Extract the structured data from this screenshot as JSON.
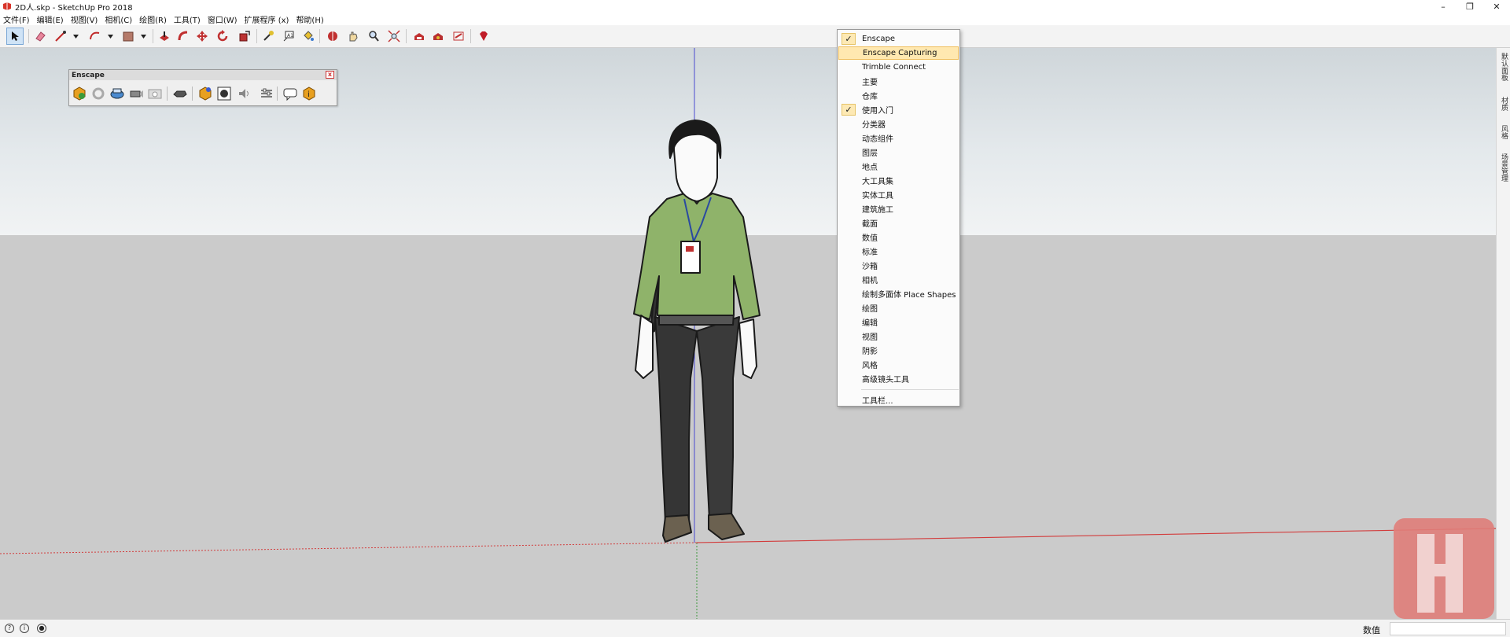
{
  "window": {
    "title": "2D人.skp - SketchUp Pro 2018",
    "minimize": "–",
    "restore": "❐",
    "close": "✕"
  },
  "menubar": [
    {
      "label": "文件(F)"
    },
    {
      "label": "编辑(E)"
    },
    {
      "label": "视图(V)"
    },
    {
      "label": "相机(C)"
    },
    {
      "label": "绘图(R)"
    },
    {
      "label": "工具(T)"
    },
    {
      "label": "窗口(W)"
    },
    {
      "label": "扩展程序 (x)"
    },
    {
      "label": "帮助(H)"
    }
  ],
  "right_tray": {
    "tabs": [
      "默认面板",
      "材质",
      "风格",
      "场景管理"
    ]
  },
  "enscape_toolbar": {
    "title": "Enscape",
    "close": "x"
  },
  "context_menu": {
    "items": [
      {
        "label": "Enscape",
        "checked": true
      },
      {
        "label": "Enscape Capturing",
        "hover": true
      },
      {
        "label": "Trimble Connect"
      },
      {
        "label": "主要"
      },
      {
        "label": "仓库"
      },
      {
        "label": "使用入门",
        "checked": true
      },
      {
        "label": "分类器"
      },
      {
        "label": "动态组件"
      },
      {
        "label": "图层"
      },
      {
        "label": "地点"
      },
      {
        "label": "大工具集"
      },
      {
        "label": "实体工具"
      },
      {
        "label": "建筑施工"
      },
      {
        "label": "截面"
      },
      {
        "label": "数值"
      },
      {
        "label": "标准"
      },
      {
        "label": "沙箱"
      },
      {
        "label": "相机"
      },
      {
        "label": "绘制多面体 Place Shapes"
      },
      {
        "label": "绘图"
      },
      {
        "label": "编辑"
      },
      {
        "label": "视图"
      },
      {
        "label": "阴影"
      },
      {
        "label": "风格"
      },
      {
        "label": "高级镜头工具"
      }
    ],
    "footer": "工具栏...",
    "check_glyph": "✓"
  },
  "statusbar": {
    "measurements_label": "数值",
    "icons": [
      "?",
      "i",
      "●"
    ]
  },
  "colors": {
    "sky": "#dde3e6",
    "ground": "#cbcbcb",
    "red_axis": "#d23c3c",
    "blue_axis": "#4a4ad0",
    "green_axis": "#3c9a3c",
    "shirt": "#8fb36a",
    "watermark": "#e07e7a"
  }
}
